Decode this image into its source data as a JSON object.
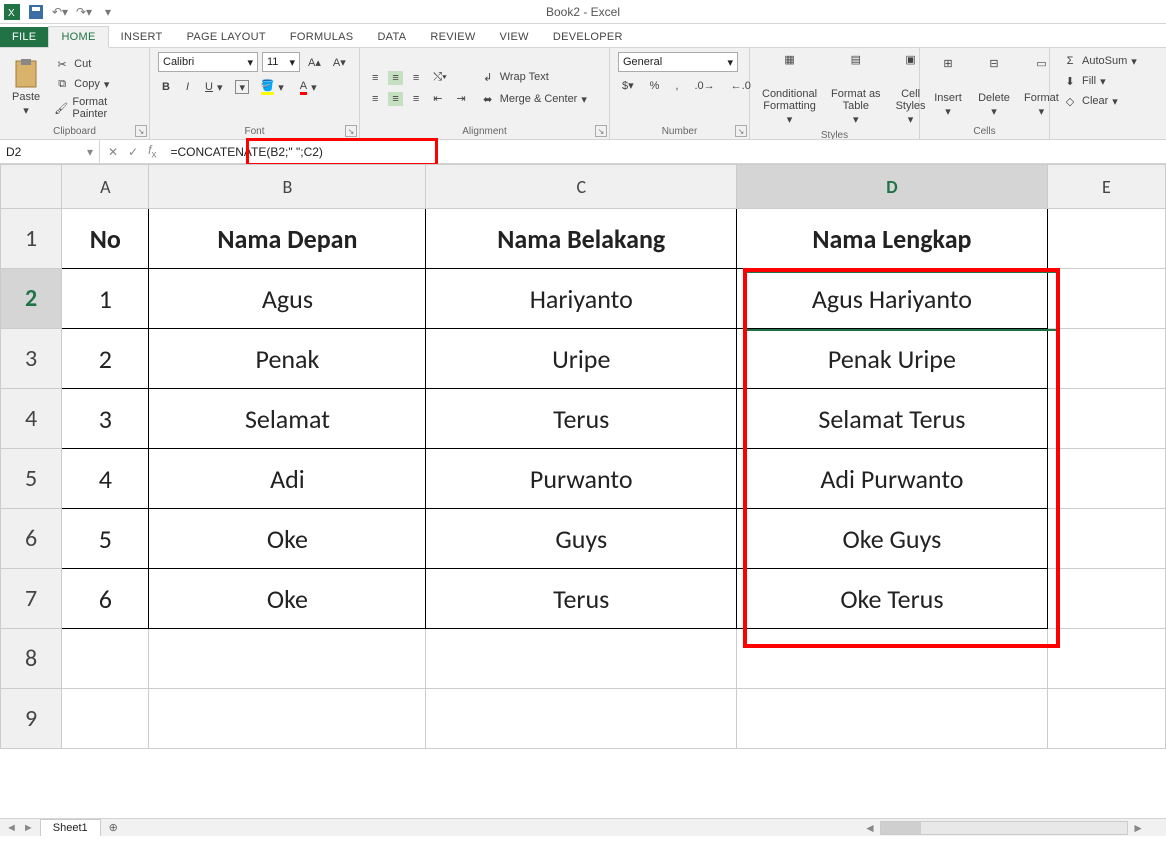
{
  "app": {
    "title": "Book2 - Excel"
  },
  "tabs": {
    "file": "FILE",
    "items": [
      "HOME",
      "INSERT",
      "PAGE LAYOUT",
      "FORMULAS",
      "DATA",
      "REVIEW",
      "VIEW",
      "DEVELOPER"
    ],
    "active": "HOME"
  },
  "ribbon": {
    "clipboard": {
      "label": "Clipboard",
      "paste": "Paste",
      "cut": "Cut",
      "copy": "Copy",
      "format_painter": "Format Painter"
    },
    "font": {
      "label": "Font",
      "name": "Calibri",
      "size": "11"
    },
    "alignment": {
      "label": "Alignment",
      "wrap": "Wrap Text",
      "merge": "Merge & Center"
    },
    "number": {
      "label": "Number",
      "format": "General"
    },
    "styles": {
      "label": "Styles",
      "cond": "Conditional\nFormatting",
      "table": "Format as\nTable",
      "cell": "Cell\nStyles"
    },
    "cells": {
      "label": "Cells",
      "insert": "Insert",
      "delete": "Delete",
      "format": "Format"
    },
    "editing": {
      "autosum": "AutoSum",
      "fill": "Fill",
      "clear": "Clear"
    }
  },
  "fx": {
    "name_box": "D2",
    "formula": "=CONCATENATE(B2;\" \";C2)"
  },
  "gridCols": [
    "A",
    "B",
    "C",
    "D",
    "E"
  ],
  "gridRows": [
    1,
    2,
    3,
    4,
    5,
    6,
    7,
    8,
    9
  ],
  "header": {
    "A": "No",
    "B": "Nama Depan",
    "C": "Nama Belakang",
    "D": "Nama Lengkap"
  },
  "data": [
    {
      "no": "1",
      "depan": "Agus",
      "belakang": "Hariyanto",
      "lengkap": "Agus Hariyanto"
    },
    {
      "no": "2",
      "depan": "Penak",
      "belakang": "Uripe",
      "lengkap": "Penak Uripe"
    },
    {
      "no": "3",
      "depan": "Selamat",
      "belakang": "Terus",
      "lengkap": "Selamat  Terus"
    },
    {
      "no": "4",
      "depan": "Adi",
      "belakang": "Purwanto",
      "lengkap": "Adi Purwanto"
    },
    {
      "no": "5",
      "depan": "Oke",
      "belakang": "Guys",
      "lengkap": "Oke Guys"
    },
    {
      "no": "6",
      "depan": "Oke",
      "belakang": "Terus",
      "lengkap": "Oke Terus"
    }
  ],
  "sheet": {
    "name": "Sheet1"
  },
  "selected": {
    "row": 2,
    "col": "D"
  }
}
